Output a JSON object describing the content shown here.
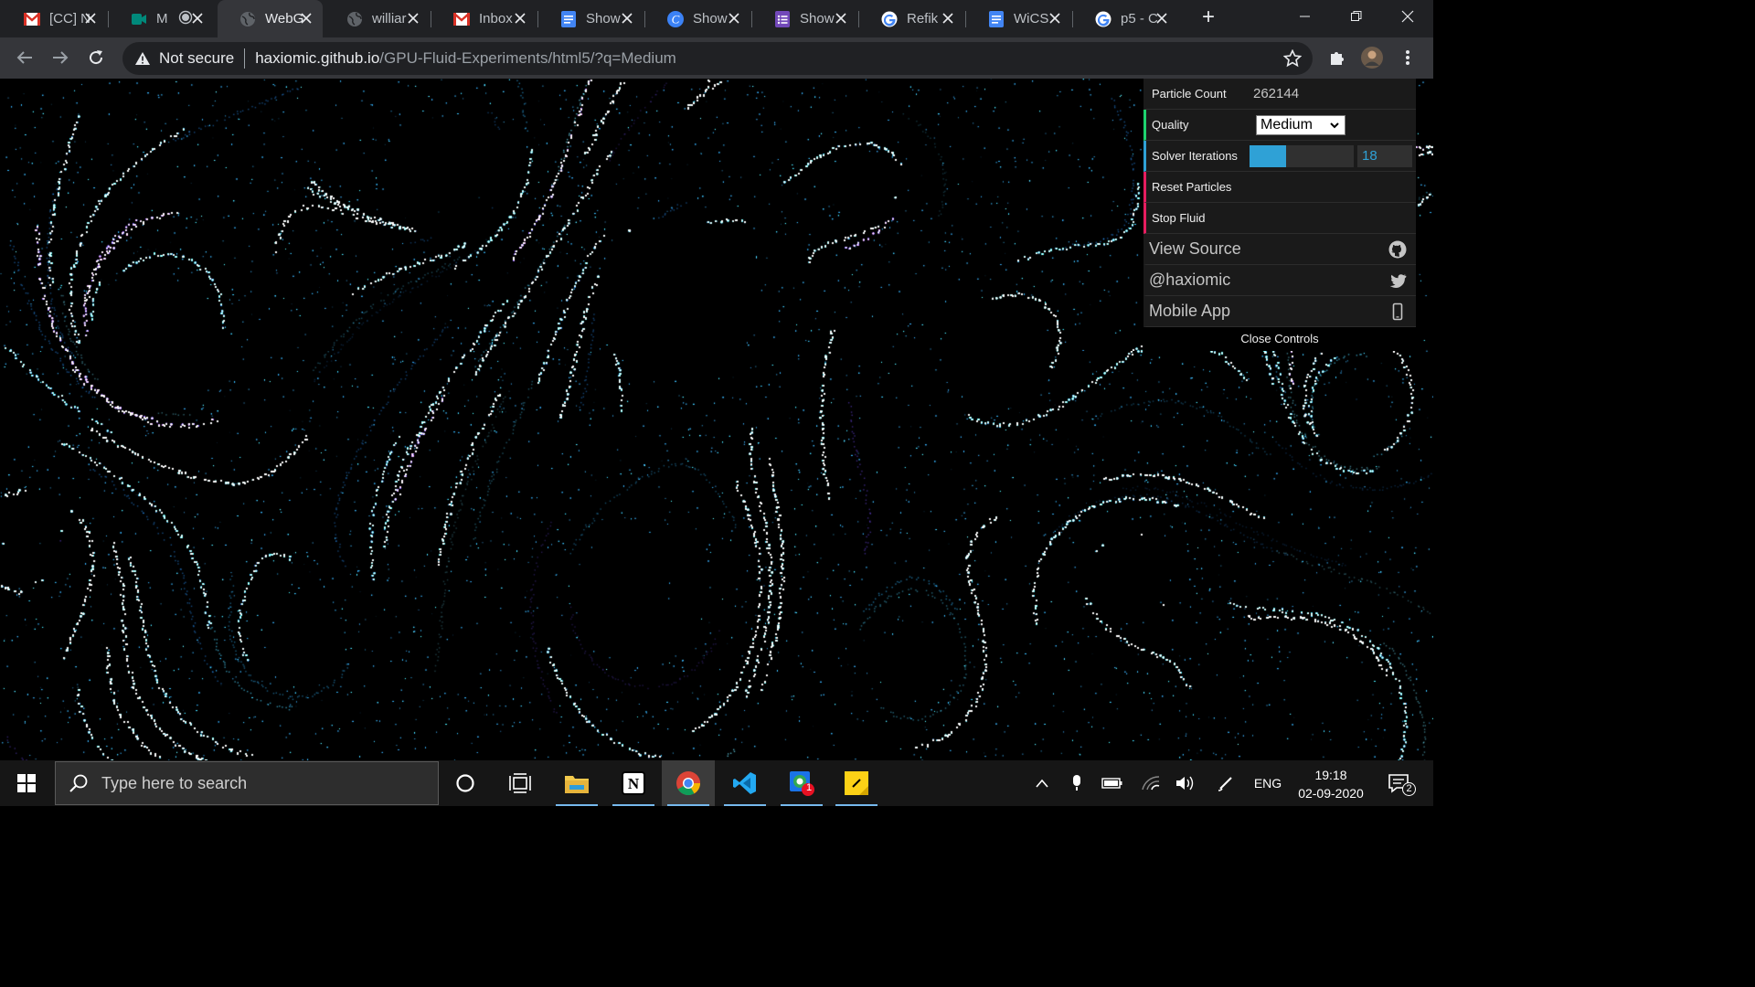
{
  "browser": {
    "tabs": [
      {
        "title": "[CC] N",
        "favicon": "gmail-icon"
      },
      {
        "title": "M",
        "favicon": "meet-icon",
        "recording": true
      },
      {
        "title": "WebG",
        "favicon": "globe-icon",
        "active": true
      },
      {
        "title": "williar",
        "favicon": "globe-icon"
      },
      {
        "title": "Inbox",
        "favicon": "gmail-icon"
      },
      {
        "title": "Show",
        "favicon": "docs-icon"
      },
      {
        "title": "Show",
        "favicon": "canva-icon"
      },
      {
        "title": "Show",
        "favicon": "forms-icon"
      },
      {
        "title": "Refik",
        "favicon": "google-icon"
      },
      {
        "title": "WiCS",
        "favicon": "docs-icon"
      },
      {
        "title": "p5 - C",
        "favicon": "google-icon"
      }
    ],
    "address": {
      "security": "Not secure",
      "host": "haxiomic.github.io",
      "path": "/GPU-Fluid-Experiments/html5/?q=Medium"
    }
  },
  "controls": {
    "particle_count": {
      "label": "Particle Count",
      "value": "262144"
    },
    "quality": {
      "label": "Quality",
      "value": "Medium"
    },
    "solver": {
      "label": "Solver Iterations",
      "value": "18",
      "fill": 0.35
    },
    "reset": {
      "label": "Reset Particles"
    },
    "stop": {
      "label": "Stop Fluid"
    },
    "view_source": {
      "label": "View Source",
      "icon": "github-icon"
    },
    "twitter": {
      "label": "@haxiomic",
      "icon": "twitter-icon"
    },
    "mobile": {
      "label": "Mobile App",
      "icon": "phone-icon"
    },
    "close_label": "Close Controls"
  },
  "taskbar": {
    "search_placeholder": "Type here to search",
    "language": "ENG",
    "time": "19:18",
    "date": "02-09-2020",
    "notification_count": "2",
    "badge_count": "1"
  },
  "colors": {
    "particle_primary": "#2fa1d6",
    "particle_bright": "#5fe8ff",
    "gui_number": "#2fa1d6",
    "gui_string": "#1ed36f",
    "gui_function": "#e61d5f"
  }
}
